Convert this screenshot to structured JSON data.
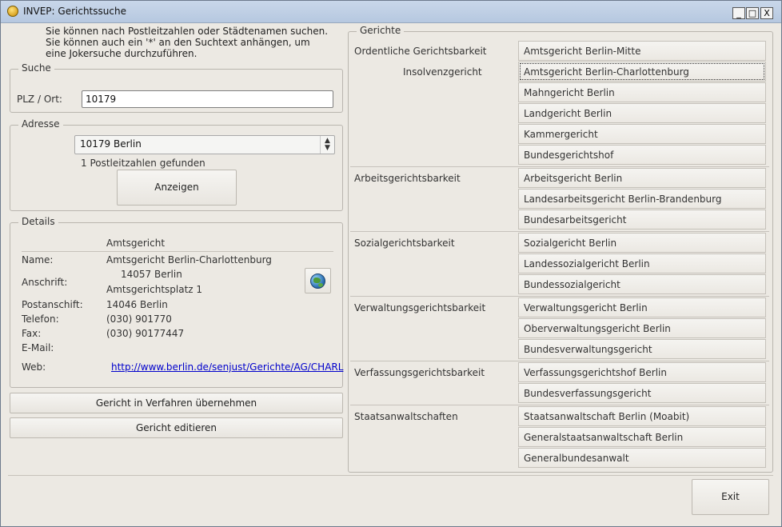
{
  "window": {
    "title": "INVEP: Gerichtssuche",
    "min_label": "_",
    "max_label": "□",
    "close_label": "X"
  },
  "hint": "Sie können nach Postleitzahlen oder Städtenamen suchen.\nSie können auch ein '*' an den Suchtext anhängen, um\neine Jokersuche durchzuführen.",
  "suche": {
    "legend": "Suche",
    "plz_label": "PLZ / Ort:",
    "plz_value": "10179"
  },
  "adresse": {
    "legend": "Adresse",
    "selected": "10179 Berlin",
    "found_text": "1 Postleitzahlen gefunden",
    "show_button": "Anzeigen"
  },
  "details": {
    "legend": "Details",
    "header": "Amtsgericht",
    "name_label": "Name:",
    "name_value": "Amtsgericht Berlin-Charlottenburg",
    "anschrift_label": "Anschrift:",
    "anschrift_line1": "14057 Berlin",
    "anschrift_line2": "Amtsgerichtsplatz 1",
    "postanschrift_label": "Postanschift:",
    "postanschrift_value": "14046 Berlin",
    "telefon_label": "Telefon:",
    "telefon_value": "(030) 901770",
    "fax_label": "Fax:",
    "fax_value": "(030) 90177447",
    "email_label": "E-Mail:",
    "email_value": "",
    "web_label": "Web:",
    "web_value": "http://www.berlin.de/senjust/Gerichte/AG/CHARL"
  },
  "actions": {
    "take_over": "Gericht in Verfahren übernehmen",
    "edit": "Gericht editieren",
    "exit": "Exit"
  },
  "gerichte": {
    "legend": "Gerichte",
    "ordentlich_label": "Ordentliche Gerichtsbarkeit",
    "insolvenz_label": "Insolvenzgericht",
    "arbeit_label": "Arbeitsgerichtsbarkeit",
    "sozial_label": "Sozialgerichtsbarkeit",
    "verwaltung_label": "Verwaltungsgerichtsbarkeit",
    "verfassung_label": "Verfassungsgerichtsbarkeit",
    "staatsanwalt_label": "Staatsanwaltschaften",
    "courts": [
      "Amtsgericht Berlin-Mitte",
      "Amtsgericht Berlin-Charlottenburg",
      "Mahngericht Berlin",
      "Landgericht Berlin",
      "Kammergericht",
      "Bundesgerichtshof",
      "Arbeitsgericht Berlin",
      "Landesarbeitsgericht Berlin-Brandenburg",
      "Bundesarbeitsgericht",
      "Sozialgericht Berlin",
      "Landessozialgericht Berlin",
      "Bundessozialgericht",
      "Verwaltungsgericht Berlin",
      "Oberverwaltungsgericht Berlin",
      "Bundesverwaltungsgericht",
      "Verfassungsgerichtshof Berlin",
      "Bundesverfassungsgericht",
      "Staatsanwaltschaft Berlin (Moabit)",
      "Generalstaatsanwaltschaft Berlin",
      "Generalbundesanwalt"
    ]
  }
}
